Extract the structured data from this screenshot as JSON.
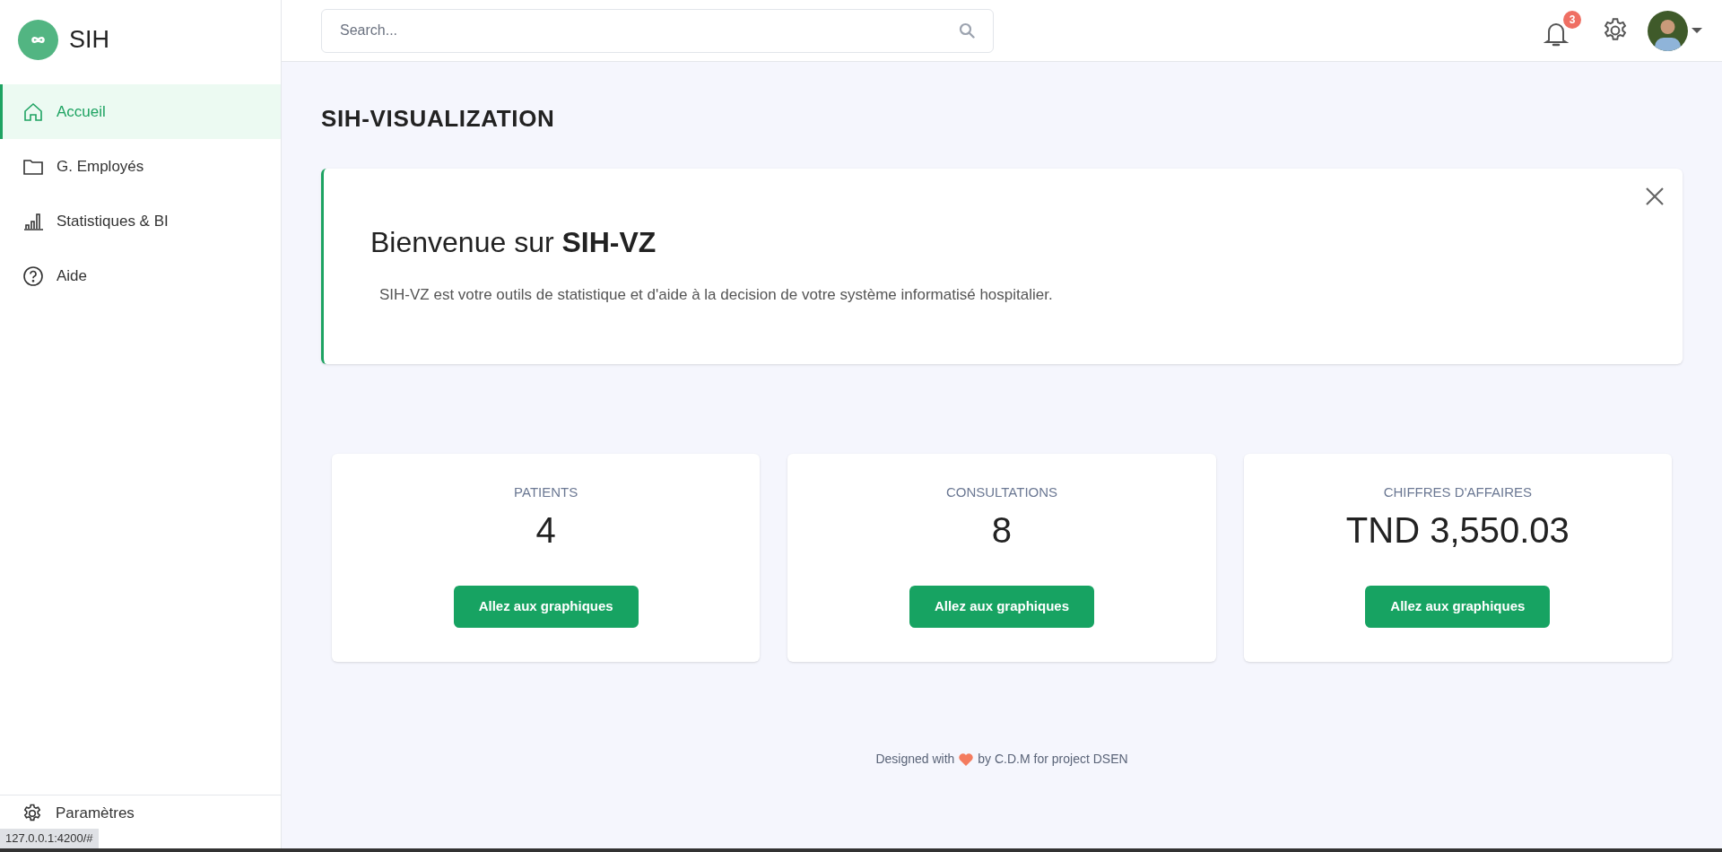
{
  "brand": {
    "name": "SIH"
  },
  "sidebar": {
    "items": [
      {
        "label": "Accueil",
        "selected": true
      },
      {
        "label": "G. Employés",
        "selected": false
      },
      {
        "label": "Statistiques & BI",
        "selected": false
      },
      {
        "label": "Aide",
        "selected": false
      }
    ],
    "footer_item": {
      "label": "Paramètres"
    }
  },
  "topbar": {
    "search": {
      "placeholder": "Search..."
    },
    "notifications": {
      "count": "3"
    }
  },
  "page_title": "SIH-VISUALIZATION",
  "welcome": {
    "heading": "Bienvenue sur **SIH-VZ**",
    "text": "SIH-VZ est votre outils de statistique et d'aide à la decision de votre système informatisé hospitalier."
  },
  "stats": [
    {
      "label": "PATIENTS",
      "value": "4",
      "button": "Allez aux graphiques"
    },
    {
      "label": "CONSULTATIONS",
      "value": "8",
      "button": "Allez aux graphiques"
    },
    {
      "label": "CHIFFRES D'AFFAIRES",
      "value": "TND 3,550.03",
      "button": "Allez aux graphiques"
    }
  ],
  "footer": {
    "before": "Designed with",
    "after": "by C.D.M for project DSEN"
  },
  "status_url": "127.0.0.1:4200/#"
}
